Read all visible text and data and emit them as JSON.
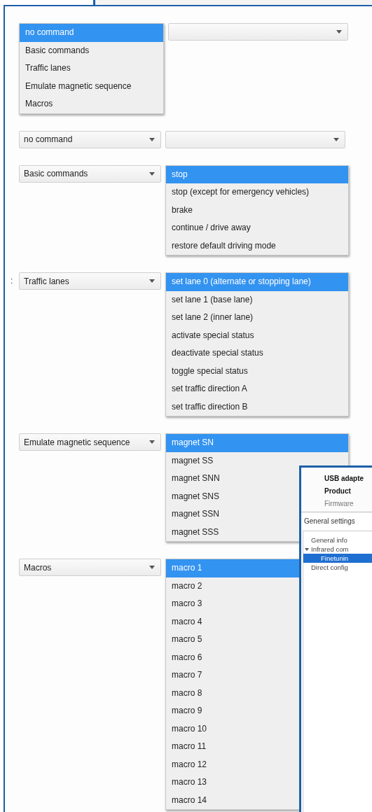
{
  "rows": [
    {
      "left": {
        "kind": "list",
        "items": [
          {
            "label": "no command",
            "selected": true
          },
          {
            "label": "Basic commands",
            "selected": false
          },
          {
            "label": "Traffic lanes",
            "selected": false
          },
          {
            "label": "Emulate magnetic sequence",
            "selected": false
          },
          {
            "label": "Macros",
            "selected": false
          }
        ]
      },
      "right": {
        "kind": "combo"
      }
    },
    {
      "left": {
        "kind": "combo",
        "value": "no command"
      },
      "right": {
        "kind": "combo"
      }
    },
    {
      "left": {
        "kind": "combo",
        "value": "Basic commands"
      },
      "right": {
        "kind": "list",
        "items": [
          {
            "label": "stop",
            "selected": true
          },
          {
            "label": "stop (except for emergency vehicles)",
            "selected": false
          },
          {
            "label": "brake",
            "selected": false
          },
          {
            "label": "continue / drive away",
            "selected": false
          },
          {
            "label": "restore default driving mode",
            "selected": false
          }
        ]
      }
    },
    {
      "prefix": ":",
      "left": {
        "kind": "combo",
        "value": "Traffic lanes"
      },
      "right": {
        "kind": "list",
        "items": [
          {
            "label": "set lane 0 (alternate or stopping lane)",
            "selected": true
          },
          {
            "label": "set lane 1 (base lane)",
            "selected": false
          },
          {
            "label": "set lane 2 (inner lane)",
            "selected": false
          },
          {
            "label": "activate special status",
            "selected": false
          },
          {
            "label": "deactivate special status",
            "selected": false
          },
          {
            "label": "toggle special status",
            "selected": false
          },
          {
            "label": "set traffic direction A",
            "selected": false
          },
          {
            "label": "set traffic direction B",
            "selected": false
          }
        ]
      }
    },
    {
      "left": {
        "kind": "combo",
        "value": "Emulate magnetic sequence"
      },
      "right": {
        "kind": "list",
        "items": [
          {
            "label": "magnet SN",
            "selected": true
          },
          {
            "label": "magnet SS",
            "selected": false
          },
          {
            "label": "magnet SNN",
            "selected": false
          },
          {
            "label": "magnet SNS",
            "selected": false
          },
          {
            "label": "magnet SSN",
            "selected": false
          },
          {
            "label": "magnet SSS",
            "selected": false
          }
        ]
      }
    },
    {
      "left": {
        "kind": "combo",
        "value": "Macros"
      },
      "right": {
        "kind": "list",
        "items": [
          {
            "label": "macro 1",
            "selected": true
          },
          {
            "label": "macro 2",
            "selected": false
          },
          {
            "label": "macro 3",
            "selected": false
          },
          {
            "label": "macro 4",
            "selected": false
          },
          {
            "label": "macro 5",
            "selected": false
          },
          {
            "label": "macro 6",
            "selected": false
          },
          {
            "label": "macro 7",
            "selected": false
          },
          {
            "label": "macro 8",
            "selected": false
          },
          {
            "label": "macro 9",
            "selected": false
          },
          {
            "label": "macro 10",
            "selected": false
          },
          {
            "label": "macro 11",
            "selected": false
          },
          {
            "label": "macro 12",
            "selected": false
          },
          {
            "label": "macro 13",
            "selected": false
          },
          {
            "label": "macro 14",
            "selected": false
          }
        ]
      }
    }
  ],
  "device_window": {
    "info": [
      {
        "label": "USB adapte",
        "kind": "heading"
      },
      {
        "label": "Product",
        "kind": "heading"
      },
      {
        "label": "Firmware",
        "kind": "detail"
      }
    ],
    "section": "General settings",
    "tree": [
      {
        "label": "General info",
        "selected": false
      },
      {
        "label": "Infrared com",
        "selected": false,
        "expanded": true,
        "children": [
          {
            "label": "Finetunin",
            "selected": true
          }
        ]
      },
      {
        "label": "Direct config",
        "selected": false
      }
    ]
  }
}
